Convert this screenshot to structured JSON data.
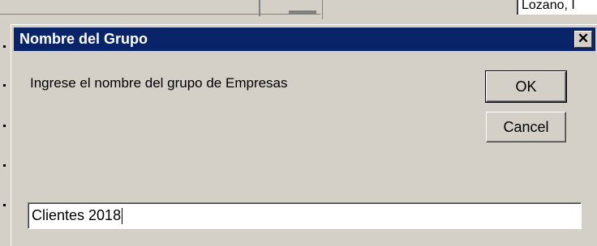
{
  "background_app": {
    "partial_text": "Lozano, I"
  },
  "dialog": {
    "title": "Nombre del Grupo",
    "close_glyph": "✕",
    "prompt": "Ingrese el nombre del grupo de Empresas",
    "ok_label": "OK",
    "cancel_label": "Cancel",
    "input_value": "Clientes 2018"
  },
  "colors": {
    "titlebar": "#0a246a",
    "face": "#d4d0c8"
  }
}
